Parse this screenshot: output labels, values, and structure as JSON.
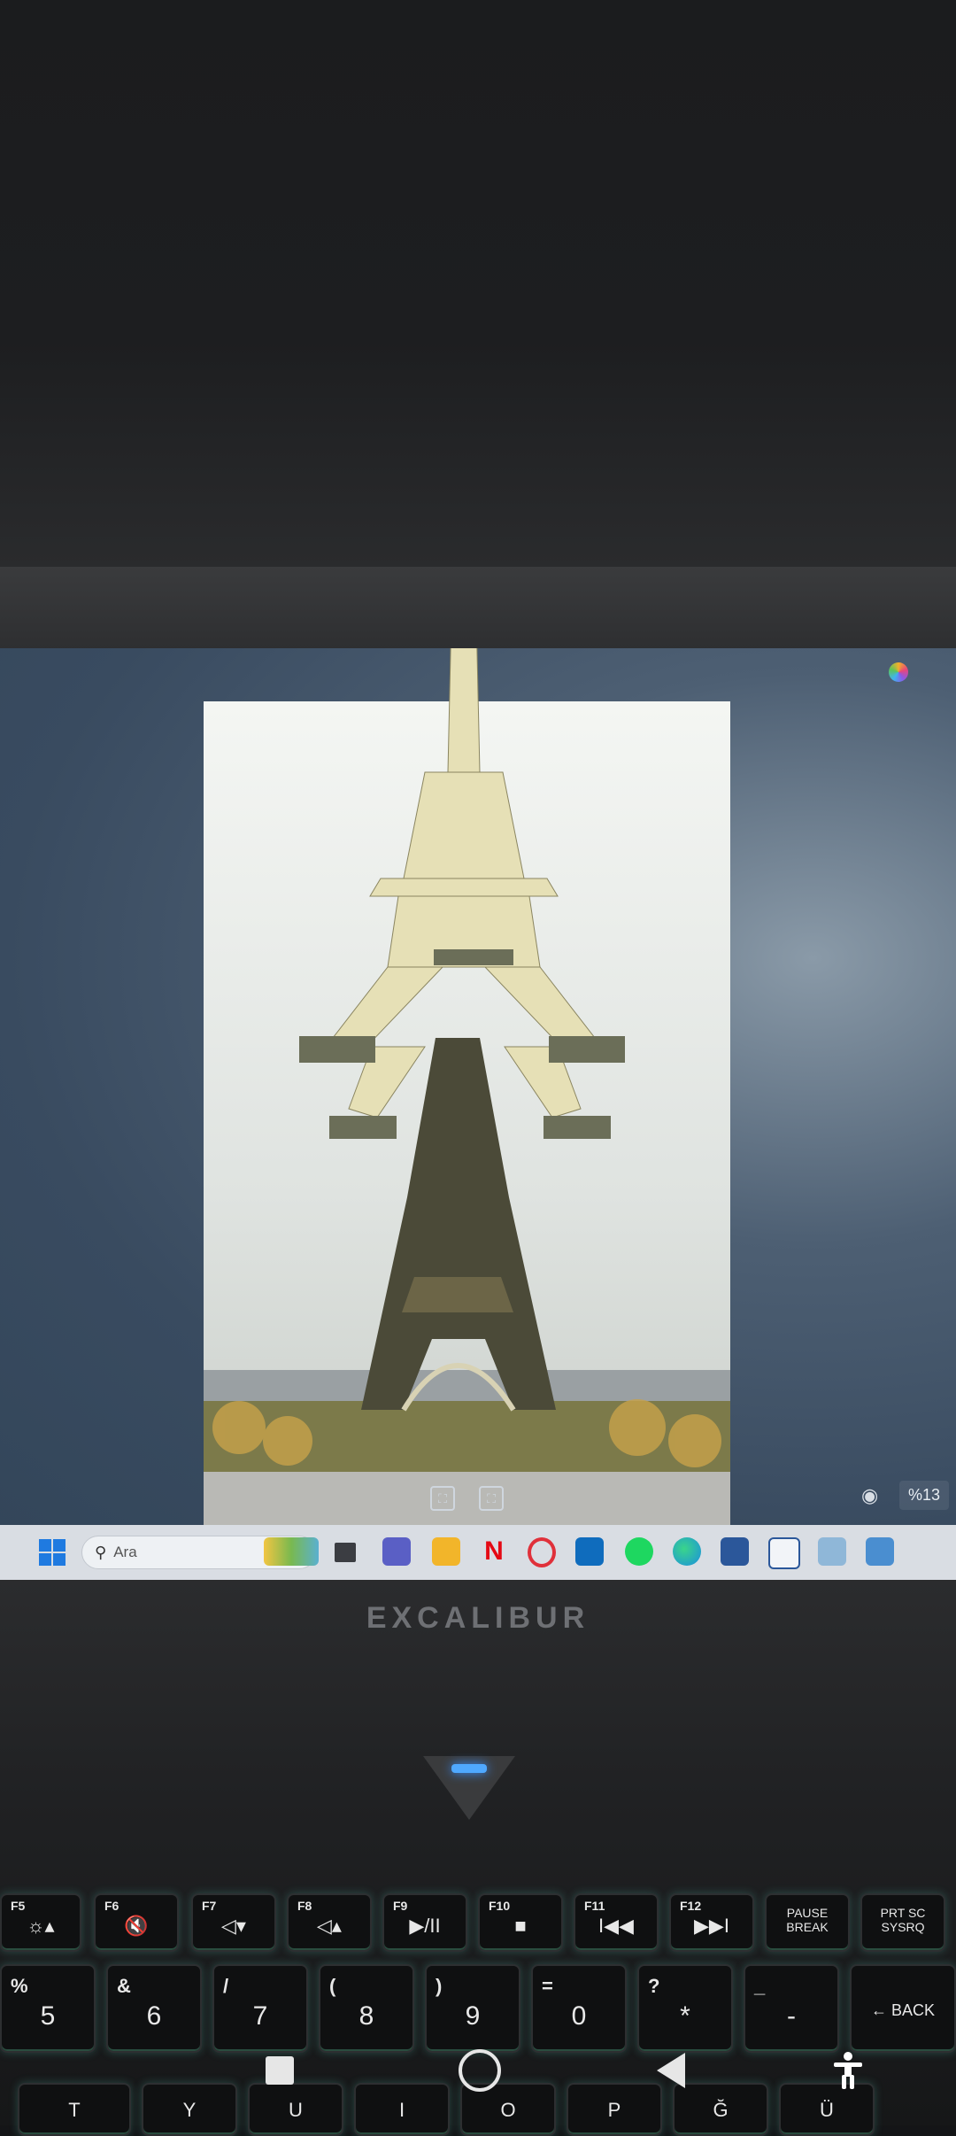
{
  "screen": {
    "zoom_badge": "%13",
    "icons": [
      "fit-screen-icon",
      "fit-screen-icon",
      "camera-icon",
      "copilot-icon"
    ]
  },
  "taskbar": {
    "search_label": "Ara",
    "apps": [
      "widgets-icon",
      "file-explorer-icon",
      "teams-icon",
      "folder-icon",
      "netflix-icon",
      "opera-icon",
      "outlook-icon",
      "spotify-icon",
      "edge-icon",
      "word-icon",
      "word-icon",
      "notepad-icon",
      "photos-icon"
    ]
  },
  "brand": "EXCALIBUR",
  "keyboard": {
    "fn_row": [
      {
        "top": "F5",
        "main": "☼▴"
      },
      {
        "top": "F6",
        "main": "🔇"
      },
      {
        "top": "F7",
        "main": "◁▾"
      },
      {
        "top": "F8",
        "main": "◁▴"
      },
      {
        "top": "F9",
        "main": "▶/II"
      },
      {
        "top": "F10",
        "main": "■"
      },
      {
        "top": "F11",
        "main": "I◀◀"
      },
      {
        "top": "F12",
        "main": "▶▶I"
      },
      {
        "top": "",
        "main": "PAUSE BREAK"
      },
      {
        "top": "",
        "main": "PRT SC SYSRQ"
      }
    ],
    "num_row": [
      {
        "top": "%",
        "main": "5"
      },
      {
        "top": "&",
        "main": "6"
      },
      {
        "top": "/",
        "main": "7"
      },
      {
        "top": "(",
        "main": "8"
      },
      {
        "top": ")",
        "main": "9"
      },
      {
        "top": "=",
        "main": "0"
      },
      {
        "top": "?",
        "main": "*"
      },
      {
        "top": "_",
        "main": "-"
      },
      {
        "top": "",
        "main": "← BACK"
      }
    ],
    "letter_row": [
      "T",
      "Y",
      "U",
      "I",
      "O",
      "P",
      "Ğ",
      "Ü"
    ]
  },
  "colors": {
    "screen_bg": "#3b4d62",
    "taskbar_bg": "#d9dde3",
    "key_glow": "#5adcc8",
    "indicator_led": "#4fa8ff"
  }
}
